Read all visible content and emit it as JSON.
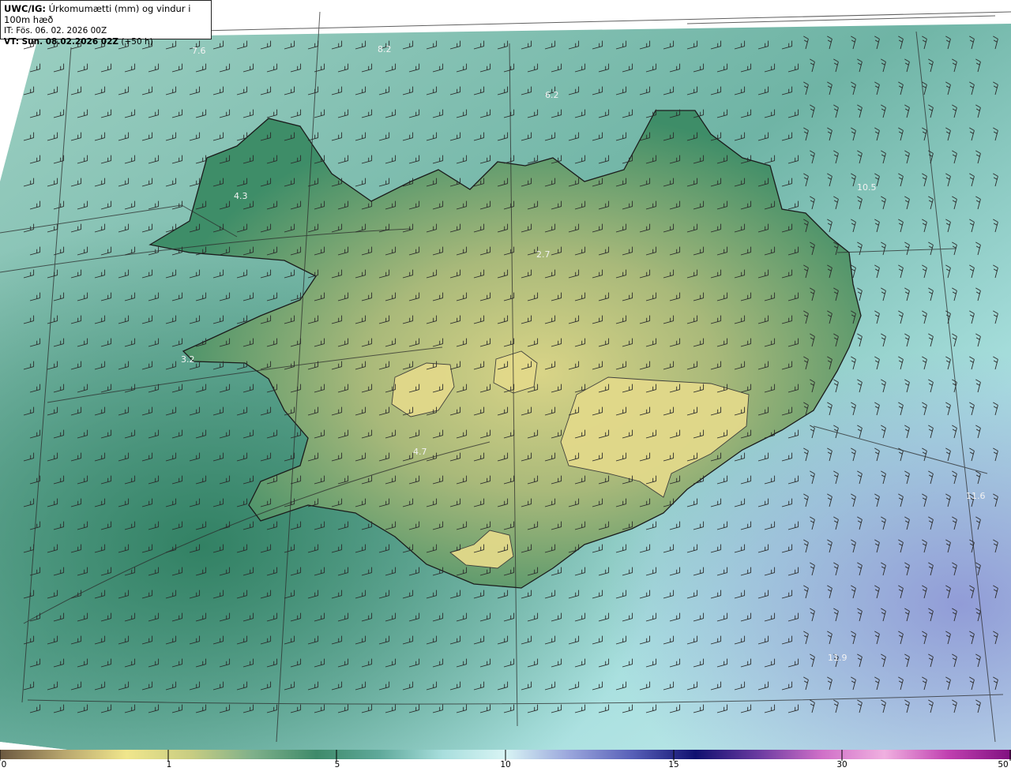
{
  "header": {
    "model": "UWC/IG:",
    "description": "Úrkomumætti (mm) og vindur i 100m hæð",
    "it_line": "IT: Fös. 06. 02. 2026 00Z",
    "vt_bold": "VT: Sun. 08.02.2026 02Z",
    "vt_offset": "(+50 h)"
  },
  "map_labels": [
    "7.6",
    "8.2",
    "6.2",
    "4.3",
    "2.7",
    "3.2",
    "4.7",
    "11.6",
    "11.9",
    "10.5"
  ],
  "colorbar": {
    "ticks": [
      "0",
      "1",
      "5",
      "10",
      "15",
      "30",
      "50"
    ],
    "stops": [
      "#6b5840",
      "#b8a66e",
      "#f0e68c",
      "#c9cd82",
      "#7fb08a",
      "#3e8a6a",
      "#5fa99a",
      "#a8dedd",
      "#d8f4f4",
      "#9aa6dc",
      "#5860b8",
      "#101070",
      "#6a3aa0",
      "#d070c8",
      "#f0b0e0",
      "#c040b0",
      "#801080"
    ]
  },
  "colors": {
    "sea_light": "#bfe8e6",
    "sea_mid": "#79bfb3",
    "sea_dark": "#3f8f74",
    "land_low": "#4f9a6e",
    "land_high": "#d4cf82",
    "ocean_blue": "#9ea9de"
  }
}
